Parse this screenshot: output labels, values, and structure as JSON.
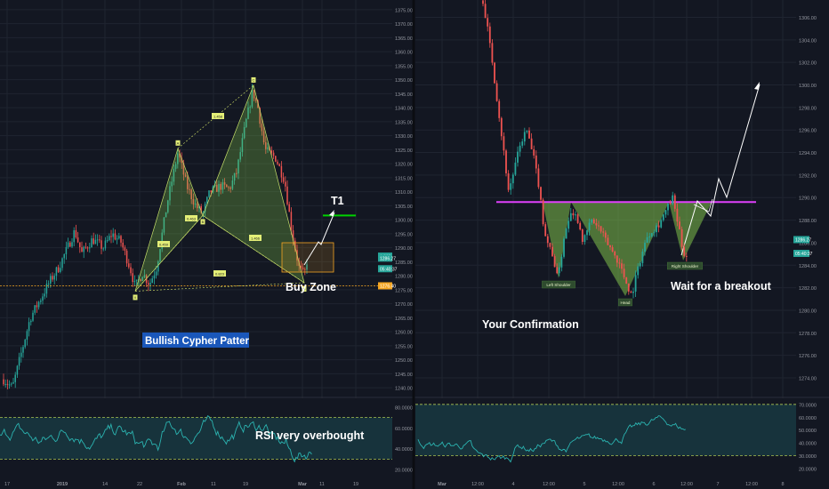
{
  "theme": {
    "background": "#131722",
    "grid": "#1f2430",
    "up_candle": "#26a69a",
    "down_candle": "#ef5350",
    "axis_text": "#9598a1",
    "pattern_fill": "#8ad04d",
    "neckline": "#e040fb",
    "support_line": "#f5a623",
    "target_line": "#00d200",
    "rsi_band": "#1b4b52",
    "rsi_line": "#2bb3b0",
    "white": "#ffffff",
    "label_box": "#1a57ba"
  },
  "chart_data": [
    {
      "type": "candlestick",
      "panel": "left",
      "price_axis": [
        "1375.00",
        "1370.00",
        "1365.00",
        "1360.00",
        "1355.00",
        "1350.00",
        "1345.00",
        "1340.00",
        "1335.00",
        "1330.00",
        "1325.00",
        "1320.00",
        "1315.00",
        "1310.00",
        "1305.00",
        "1300.00",
        "1295.00",
        "1290.00",
        "1285.00",
        "1280.00",
        "1275.00",
        "1270.00",
        "1265.00",
        "1260.00",
        "1255.00",
        "1250.00",
        "1245.00",
        "1240.00"
      ],
      "time_axis": [
        "17",
        "2019",
        "14",
        "22",
        "Feb",
        "11",
        "19",
        "Mar",
        "11",
        "19"
      ],
      "ylim": [
        1237.5,
        1377.5
      ],
      "price_tags": [
        {
          "text": "1,335",
          "value": 1287.0,
          "color": "#26a69a"
        },
        {
          "text": "1286.27",
          "value": 1286.3,
          "color": "#26a69a"
        },
        {
          "text": "05:40:37",
          "value": 1284.4,
          "color": "#26a69a"
        },
        {
          "text": "1276.40",
          "value": 1276.4,
          "color": "#f5a623"
        }
      ],
      "support_level": 1276.4,
      "pattern_points": [
        {
          "label": "X",
          "price": 1274.5
        },
        {
          "label": "A",
          "price": 1325.5
        },
        {
          "label": "B",
          "price": 1301.5
        },
        {
          "label": "C",
          "price": 1348.0
        },
        {
          "label": "D",
          "price": 1277.5
        }
      ],
      "pattern_ratios": [
        "0.459",
        "1.458",
        "0.463",
        "1.466",
        "0.823"
      ],
      "target": {
        "label": "T1",
        "price": 1301.5
      },
      "annotations": [
        "Buy Zone",
        "Bullish Cypher Patter"
      ],
      "rsi": {
        "axis": [
          "80.0000",
          "60.0000",
          "40.0000",
          "20.0000"
        ],
        "levels": [
          70,
          30
        ],
        "annotation": "RSI very overbought"
      }
    },
    {
      "type": "candlestick",
      "panel": "right",
      "price_axis": [
        "1306.00",
        "1304.00",
        "1302.00",
        "1300.00",
        "1298.00",
        "1296.00",
        "1294.00",
        "1292.00",
        "1290.00",
        "1288.00",
        "1286.00",
        "1284.00",
        "1282.00",
        "1280.00",
        "1278.00",
        "1276.00",
        "1274.00"
      ],
      "time_axis": [
        "Mar",
        "12:00",
        "4",
        "12:00",
        "5",
        "12:00",
        "6",
        "12:00",
        "7",
        "12:00",
        "8"
      ],
      "ylim": [
        1272.5,
        1307.3
      ],
      "price_tags": [
        {
          "text": "-1,885",
          "value": 1286.27,
          "color": "#26a69a"
        },
        {
          "text": "1286.27",
          "value": 1286.27,
          "color": "#26a69a"
        },
        {
          "text": "05:40:37",
          "value": 1285.6,
          "color": "#26a69a"
        }
      ],
      "neckline": 1289.6,
      "head_and_shoulders": [
        {
          "label": "Left Shoulder",
          "price": 1283.0
        },
        {
          "label": "Head",
          "price": 1280.9
        },
        {
          "label": "Right Shoulder",
          "price": 1284.6
        }
      ],
      "annotations": [
        "Wait for a breakout",
        "Your Confirmation"
      ],
      "rsi": {
        "axis": [
          "70.0000",
          "60.0000",
          "50.0000",
          "40.0000",
          "30.0000",
          "20.0000"
        ],
        "levels": [
          70,
          30
        ]
      }
    }
  ]
}
